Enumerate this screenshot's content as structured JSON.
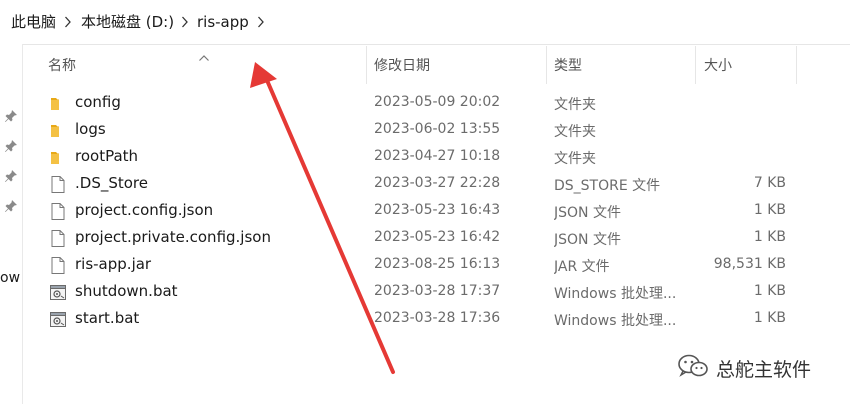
{
  "breadcrumb": {
    "items": [
      "此电脑",
      "本地磁盘 (D:)",
      "ris-app"
    ]
  },
  "sidebar": {
    "partial_text": "ow"
  },
  "columns": {
    "name": "名称",
    "modified": "修改日期",
    "type": "类型",
    "size": "大小"
  },
  "files": [
    {
      "icon": "folder-icon",
      "name": "config",
      "modified": "2023-05-09 20:02",
      "type": "文件夹",
      "size": ""
    },
    {
      "icon": "folder-icon",
      "name": "logs",
      "modified": "2023-06-02 13:55",
      "type": "文件夹",
      "size": ""
    },
    {
      "icon": "folder-icon",
      "name": "rootPath",
      "modified": "2023-04-27 10:18",
      "type": "文件夹",
      "size": ""
    },
    {
      "icon": "file-icon",
      "name": ".DS_Store",
      "modified": "2023-03-27 22:28",
      "type": "DS_STORE 文件",
      "size": "7 KB"
    },
    {
      "icon": "file-icon",
      "name": "project.config.json",
      "modified": "2023-05-23 16:43",
      "type": "JSON 文件",
      "size": "1 KB"
    },
    {
      "icon": "file-icon",
      "name": "project.private.config.json",
      "modified": "2023-05-23 16:42",
      "type": "JSON 文件",
      "size": "1 KB"
    },
    {
      "icon": "file-icon",
      "name": "ris-app.jar",
      "modified": "2023-08-25 16:13",
      "type": "JAR 文件",
      "size": "98,531 KB"
    },
    {
      "icon": "batch-file-icon",
      "name": "shutdown.bat",
      "modified": "2023-03-28 17:37",
      "type": "Windows 批处理...",
      "size": "1 KB"
    },
    {
      "icon": "batch-file-icon",
      "name": "start.bat",
      "modified": "2023-03-28 17:36",
      "type": "Windows 批处理...",
      "size": "1 KB"
    }
  ],
  "watermark": {
    "text": "总舵主软件"
  },
  "colors": {
    "folder": "#f4c144",
    "arrow": "#e53935",
    "divider": "#e6e6e6"
  }
}
